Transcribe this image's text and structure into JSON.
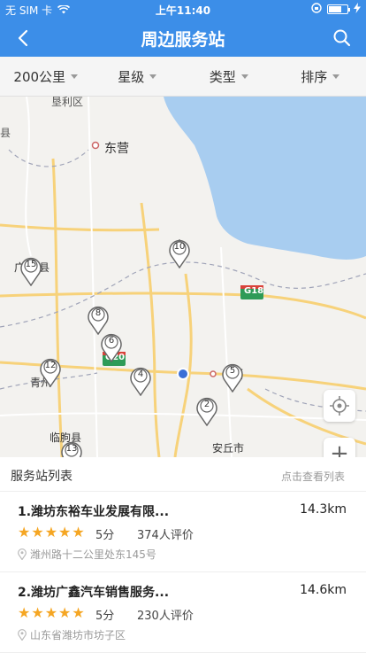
{
  "status_bar": {
    "carrier": "无 SIM 卡",
    "time": "上午11:40"
  },
  "nav": {
    "title": "周边服务站",
    "back_icon": "chevron-left-icon",
    "search_icon": "search-icon"
  },
  "filters": [
    {
      "label": "200公里"
    },
    {
      "label": "星级"
    },
    {
      "label": "类型"
    },
    {
      "label": "排序"
    }
  ],
  "map": {
    "places": {
      "dongying": "东营",
      "qingzhou": "青州",
      "linqu": "临朐县",
      "anqiu": "安丘市",
      "gaomi_part": "j",
      "county_left": "县",
      "guang": "广",
      "xian2": "县",
      "top_label": "垦利区"
    },
    "highways": {
      "g18": "G18",
      "g20": "G20"
    },
    "markers": [
      "2",
      "4",
      "5",
      "6",
      "8",
      "10",
      "12",
      "13",
      "15"
    ]
  },
  "list": {
    "title": "服务站列表",
    "link": "点击查看列表",
    "items": [
      {
        "name": "1.潍坊东裕车业发展有限...",
        "distance": "14.3km",
        "score": "5分",
        "reviews": "374人评价",
        "address": "潍州路十二公里处东145号"
      },
      {
        "name": "2.潍坊广鑫汽车销售服务...",
        "distance": "14.6km",
        "score": "5分",
        "reviews": "230人评价",
        "address": "山东省潍坊市坊子区"
      }
    ]
  },
  "colors": {
    "primary": "#3c8ee8",
    "star": "#f5a623",
    "water": "#a8cdf0"
  }
}
